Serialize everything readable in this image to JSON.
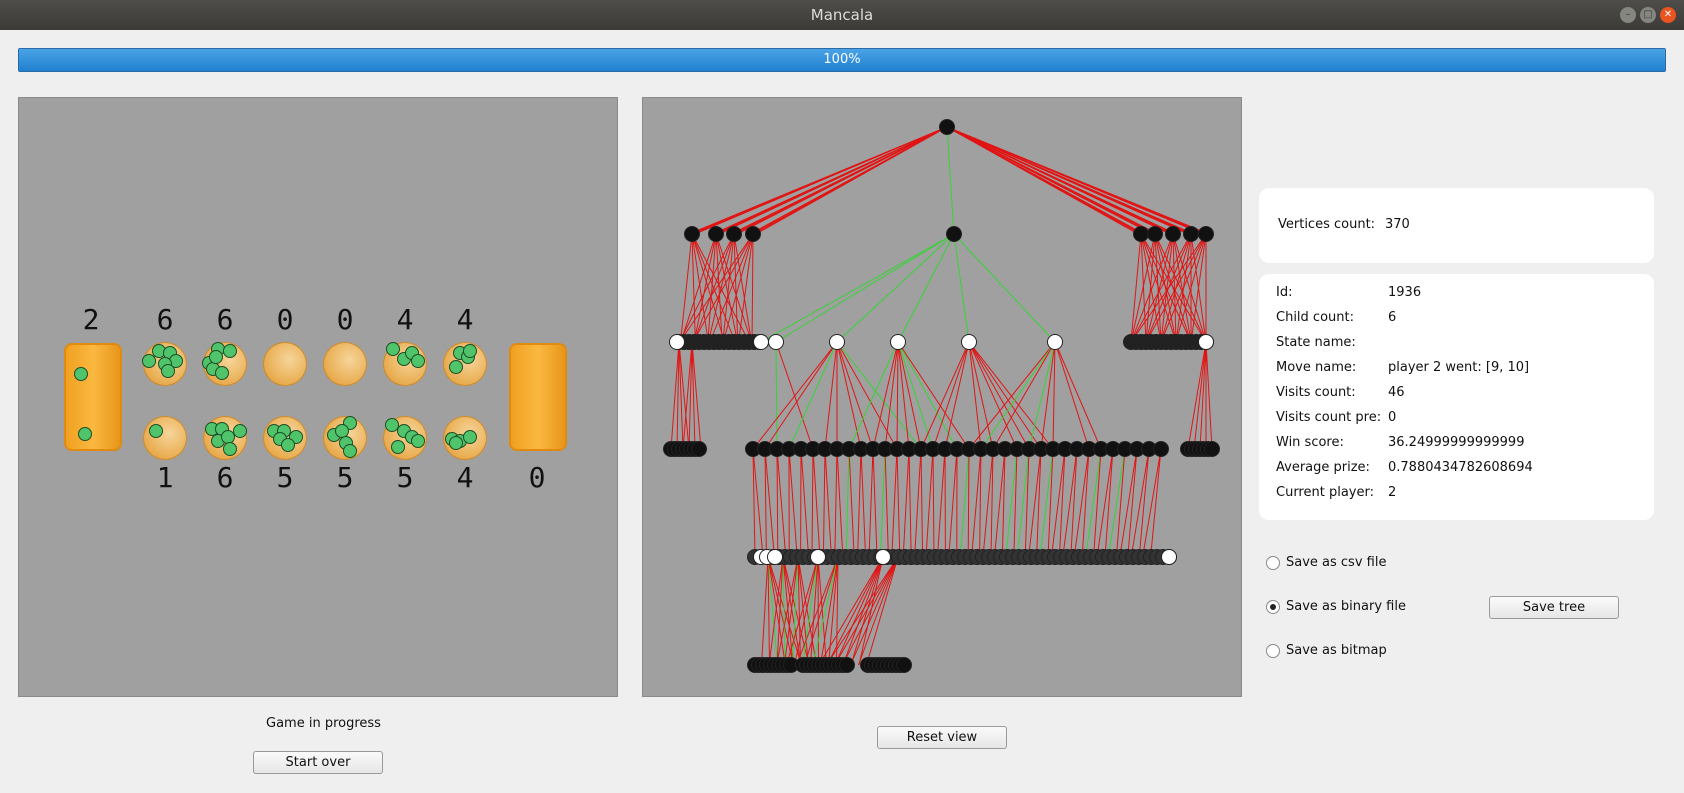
{
  "window": {
    "title": "Mancala",
    "controls": [
      "minimize-icon",
      "maximize-icon",
      "close-icon"
    ]
  },
  "progress": {
    "label": "100%",
    "value": 1.0
  },
  "board": {
    "top_counts": [
      "2",
      "6",
      "6",
      "0",
      "0",
      "4",
      "4"
    ],
    "bottom_counts": [
      "1",
      "6",
      "5",
      "5",
      "5",
      "4",
      "0"
    ],
    "top_pits": [
      6,
      6,
      0,
      0,
      4,
      4
    ],
    "bottom_pits": [
      1,
      6,
      5,
      5,
      5,
      4
    ],
    "left_store": 2,
    "right_store": 0,
    "stone_color": "#4fc46a",
    "pit_color": "#e8aa4c",
    "store_color": "#f7a627"
  },
  "status": {
    "text": "Game in progress"
  },
  "buttons": {
    "start_over": "Start over",
    "reset_view": "Reset view",
    "save_tree": "Save tree"
  },
  "tree_view": {
    "edge_colors": {
      "explored": "#e11414",
      "best": "#35d435"
    }
  },
  "vertices": {
    "label": "Vertices count:",
    "value": "370"
  },
  "node_info": [
    {
      "label": "Id:",
      "value": "1936"
    },
    {
      "label": "Child count:",
      "value": "6"
    },
    {
      "label": "State name:",
      "value": ""
    },
    {
      "label": "Move name:",
      "value": "player 2 went: [9, 10]"
    },
    {
      "label": "Visits count:",
      "value": "46"
    },
    {
      "label": "Visits count pre:",
      "value": "0"
    },
    {
      "label": "Win score:",
      "value": "36.24999999999999"
    },
    {
      "label": "Average prize:",
      "value": "0.7880434782608694"
    },
    {
      "label": "Current player:",
      "value": "2"
    }
  ],
  "save_options": [
    {
      "label": "Save as csv file",
      "selected": false
    },
    {
      "label": "Save as binary file",
      "selected": true
    },
    {
      "label": "Save as bitmap",
      "selected": false
    }
  ]
}
